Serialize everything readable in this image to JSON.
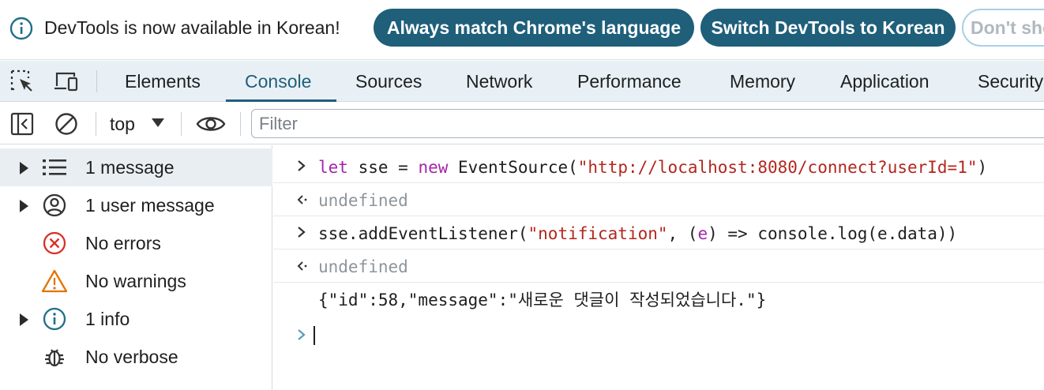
{
  "infobar": {
    "message": "DevTools is now available in Korean!",
    "buttons": {
      "match": "Always match Chrome's language",
      "switch": "Switch DevTools to Korean",
      "dont_show": "Don't show again"
    }
  },
  "tabs": [
    "Elements",
    "Console",
    "Sources",
    "Network",
    "Performance",
    "Memory",
    "Application",
    "Security"
  ],
  "active_tab": "Console",
  "console_toolbar": {
    "context": "top",
    "filter_placeholder": "Filter"
  },
  "sidebar": {
    "items": [
      {
        "label": "1 message",
        "icon": "list-icon",
        "expandable": true,
        "selected": true
      },
      {
        "label": "1 user message",
        "icon": "user-circle-icon",
        "expandable": true,
        "selected": false
      },
      {
        "label": "No errors",
        "icon": "error-icon",
        "expandable": false,
        "selected": false
      },
      {
        "label": "No warnings",
        "icon": "warning-icon",
        "expandable": false,
        "selected": false
      },
      {
        "label": "1 info",
        "icon": "info-icon",
        "expandable": true,
        "selected": false
      },
      {
        "label": "No verbose",
        "icon": "bug-icon",
        "expandable": false,
        "selected": false
      }
    ]
  },
  "console": {
    "lines": [
      {
        "type": "input",
        "parts": [
          {
            "t": "let",
            "c": "kw"
          },
          {
            "t": " sse = ",
            "c": ""
          },
          {
            "t": "new",
            "c": "kw"
          },
          {
            "t": " EventSource(",
            "c": ""
          },
          {
            "t": "\"http://localhost:8080/connect?userId=1\"",
            "c": "str"
          },
          {
            "t": ")",
            "c": ""
          }
        ]
      },
      {
        "type": "result",
        "parts": [
          {
            "t": "undefined",
            "c": "gray"
          }
        ]
      },
      {
        "type": "input",
        "parts": [
          {
            "t": "sse.addEventListener(",
            "c": ""
          },
          {
            "t": "\"notification\"",
            "c": "str"
          },
          {
            "t": ", (",
            "c": ""
          },
          {
            "t": "e",
            "c": "kw"
          },
          {
            "t": ") => console.log(e.data))",
            "c": ""
          }
        ]
      },
      {
        "type": "result",
        "parts": [
          {
            "t": "undefined",
            "c": "gray"
          }
        ]
      },
      {
        "type": "log",
        "parts": [
          {
            "t": "{\"id\":58,\"message\":\"새로운 댓글이 작성되었습니다.\"}",
            "c": ""
          }
        ]
      }
    ]
  },
  "colors": {
    "accent": "#1f5f7a",
    "keyword": "#a326a8",
    "string": "#b3261e",
    "error": "#d93025",
    "warning": "#e37400",
    "info": "#1f6f8b"
  }
}
